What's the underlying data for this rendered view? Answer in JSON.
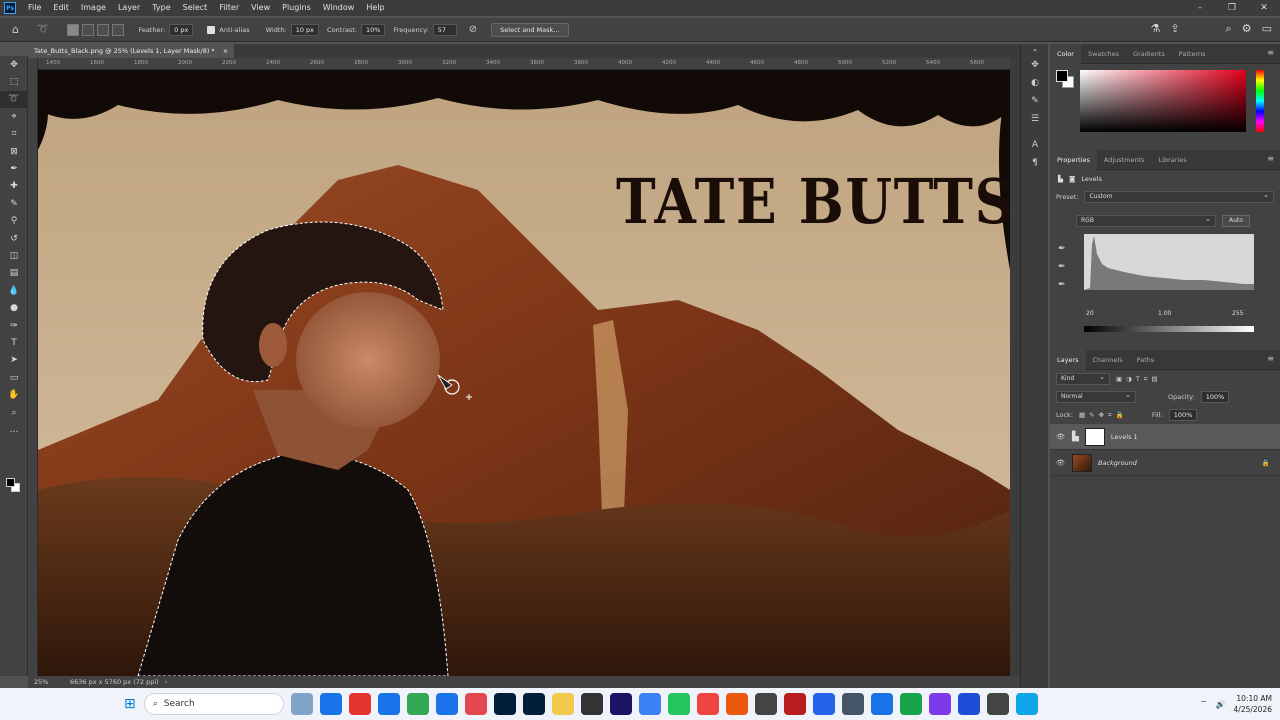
{
  "menu": [
    "File",
    "Edit",
    "Image",
    "Layer",
    "Type",
    "Select",
    "Filter",
    "View",
    "Plugins",
    "Window",
    "Help"
  ],
  "options": {
    "feather_label": "Feather:",
    "feather_value": "0 px",
    "antialias_label": "Anti-alias",
    "width_label": "Width:",
    "width_value": "10 px",
    "contrast_label": "Contrast:",
    "contrast_value": "10%",
    "frequency_label": "Frequency:",
    "frequency_value": "57",
    "select_mask_label": "Select and Mask..."
  },
  "document": {
    "tab_title": "Tate_Butts_Black.png @ 25% (Levels 1, Layer Mask/8) *",
    "canvas_title": "TATE BUTTS",
    "ruler_ticks": [
      "1400",
      "1600",
      "1800",
      "2000",
      "2200",
      "2400",
      "2600",
      "2800",
      "3000",
      "3200",
      "3400",
      "3600",
      "3800",
      "4000",
      "4200",
      "4400",
      "4600",
      "4800",
      "5000",
      "5200",
      "5400",
      "5600"
    ]
  },
  "status": {
    "zoom": "25%",
    "size": "6636 px x 5760 px (72 ppi)"
  },
  "color_panel": {
    "tabs": [
      "Color",
      "Swatches",
      "Gradients",
      "Patterns"
    ],
    "fg": "#000000",
    "bg": "#ffffff"
  },
  "properties": {
    "tabs": [
      "Properties",
      "Adjustments",
      "Libraries"
    ],
    "type": "Levels",
    "preset_label": "Preset:",
    "preset_value": "Custom",
    "channel": "RGB",
    "auto_label": "Auto",
    "input_black": "20",
    "input_gamma": "1.00",
    "input_white": "255"
  },
  "layers": {
    "tabs": [
      "Layers",
      "Channels",
      "Paths"
    ],
    "filter_kind": "Kind",
    "blend_mode": "Normal",
    "opacity_label": "Opacity:",
    "opacity_value": "100%",
    "lock_label": "Lock:",
    "fill_label": "Fill:",
    "fill_value": "100%",
    "items": [
      {
        "name": "Levels 1"
      },
      {
        "name": "Background"
      }
    ]
  },
  "taskbar": {
    "search_placeholder": "Search",
    "time": "10:10 AM",
    "date": "4/25/2026"
  }
}
